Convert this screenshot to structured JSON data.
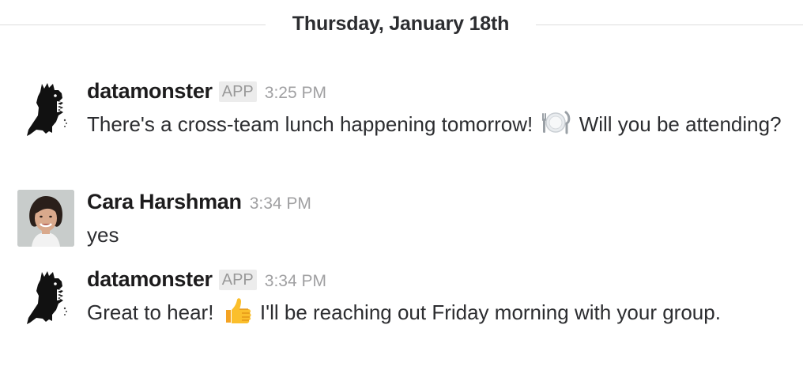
{
  "day_divider": {
    "label": "Thursday, January 18th"
  },
  "messages": [
    {
      "sender": "datamonster",
      "badge": "APP",
      "time": "3:25 PM",
      "text_before": "There's a cross-team lunch happening tomorrow!",
      "emoji": "plate-cutlery-icon",
      "text_after": "Will you be attending?"
    },
    {
      "sender": "Cara Harshman",
      "time": "3:34 PM",
      "text": "yes"
    },
    {
      "sender": "datamonster",
      "badge": "APP",
      "time": "3:34 PM",
      "text_before": "Great to hear!",
      "emoji": "thumbs-up-icon",
      "text_after": "I'll be reaching out Friday morning with your group."
    }
  ],
  "colors": {
    "text": "#2c2d30",
    "timestamp": "#a0a0a2",
    "badge_bg": "#ececec",
    "divider": "#dddddd"
  }
}
